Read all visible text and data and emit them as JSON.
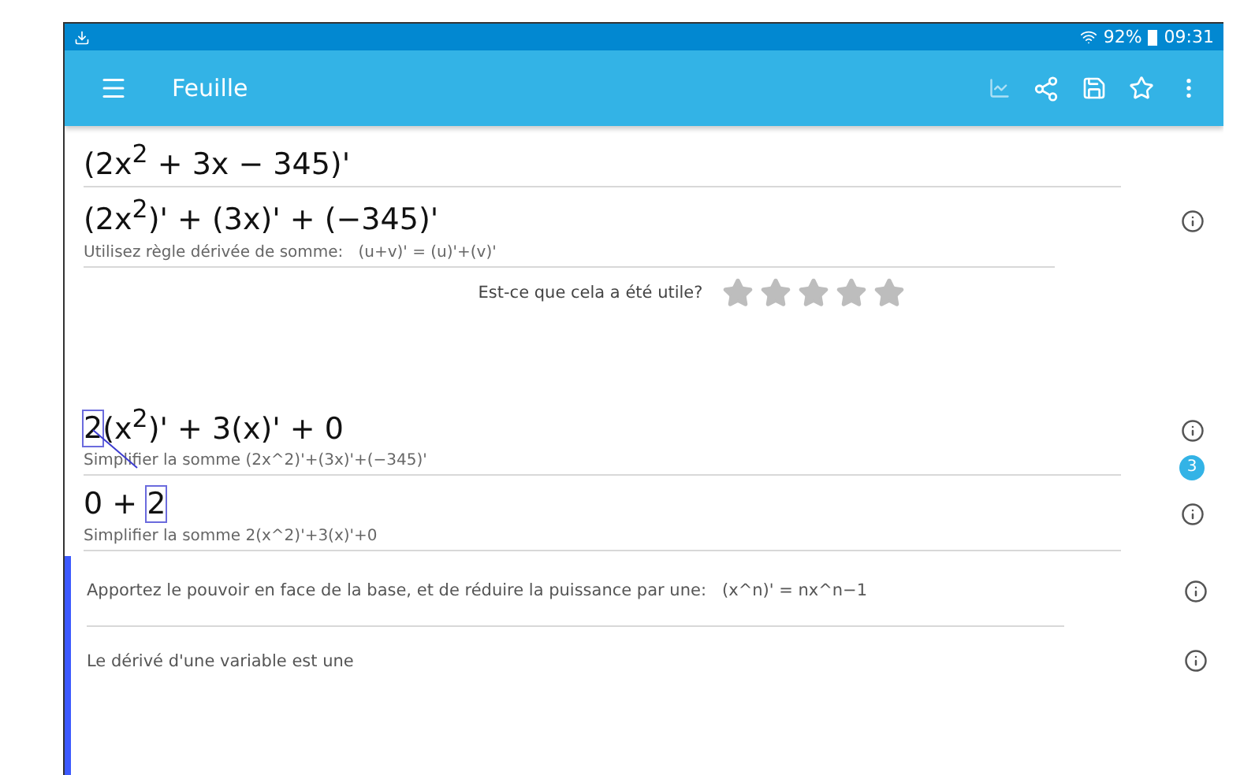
{
  "status_bar": {
    "battery": "92%",
    "time": "09:31"
  },
  "app_bar": {
    "title": "Feuille"
  },
  "steps": [
    {
      "kind": "expression",
      "segments": [
        {
          "text": "(2x$^{2}$ + 3x − 345)'",
          "highlighted": false
        }
      ]
    },
    {
      "kind": "step",
      "segments": [
        {
          "text": "(2x$^{2}$)' + (3x)' + (−345)'",
          "highlighted": false
        }
      ],
      "note": "Utilisez règle dérivée de somme:   (u+v)' = (u)'+(v)'"
    },
    {
      "kind": "rating",
      "question": "Est-ce que cela a été utile?",
      "stars": 0
    },
    {
      "kind": "step",
      "segments": [
        {
          "text": "2",
          "highlighted": true
        },
        {
          "text": "(x$^{2}$)' + 3(x)' + 0",
          "highlighted": false
        }
      ],
      "note": "Simplifier la somme (2x^2)'+(3x)'+(−345)'",
      "badge": "3"
    },
    {
      "kind": "step",
      "segments": [
        {
          "text": "0 + ",
          "highlighted": false
        },
        {
          "text": "2",
          "highlighted": true
        }
      ],
      "note": "Simplifier la somme 2(x^2)'+3(x)'+0"
    }
  ],
  "sub_steps": [
    "Apportez le pouvoir en face de la base, et de réduire la puissance par une:   (x^n)' = nx^n−1",
    "Le dérivé d'une variable est une"
  ]
}
